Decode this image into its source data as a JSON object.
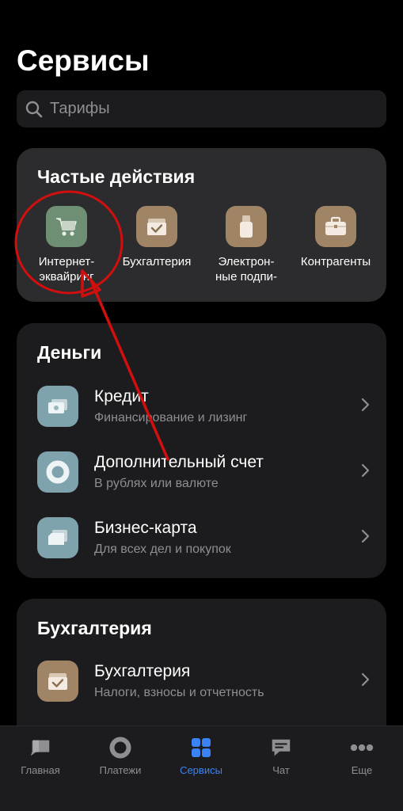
{
  "page": {
    "title": "Сервисы"
  },
  "search": {
    "placeholder": "Тарифы"
  },
  "frequent": {
    "title": "Частые действия",
    "items": [
      {
        "label": "Интернет-\nэквайринг",
        "icon": "cart-icon",
        "color": "#6e8f74"
      },
      {
        "label": "Бухгалтерия",
        "icon": "accounting-check-icon",
        "color": "#a08466"
      },
      {
        "label": "Электрон-\nные подпи-",
        "icon": "usb-token-icon",
        "color": "#a08466"
      },
      {
        "label": "Контрагенты",
        "icon": "briefcase-icon",
        "color": "#a08466"
      }
    ]
  },
  "money": {
    "title": "Деньги",
    "items": [
      {
        "title": "Кредит",
        "subtitle": "Финансирование и лизинг",
        "icon": "banknote-icon",
        "color": "#7fa3ad"
      },
      {
        "title": "Дополнительный счет",
        "subtitle": "В рублях или валюте",
        "icon": "ring-icon",
        "color": "#7fa3ad"
      },
      {
        "title": "Бизнес-карта",
        "subtitle": "Для всех дел и покупок",
        "icon": "card-icon",
        "color": "#7fa3ad"
      }
    ]
  },
  "accounting": {
    "title": "Бухгалтерия",
    "items": [
      {
        "title": "Бухгалтерия",
        "subtitle": "Налоги, взносы и отчетность",
        "icon": "accounting-check-icon",
        "color": "#a08466"
      }
    ]
  },
  "tabbar": {
    "items": [
      {
        "label": "Главная",
        "icon": "home-bubble-icon",
        "active": false
      },
      {
        "label": "Платежи",
        "icon": "payments-ring-icon",
        "active": false
      },
      {
        "label": "Сервисы",
        "icon": "services-grid-icon",
        "active": true
      },
      {
        "label": "Чат",
        "icon": "chat-icon",
        "active": false
      },
      {
        "label": "Еще",
        "icon": "more-dots-icon",
        "active": false
      }
    ],
    "active_color": "#3b82f6",
    "inactive_color": "#8e8e93"
  },
  "annotation": {
    "color": "#d10f0f"
  }
}
